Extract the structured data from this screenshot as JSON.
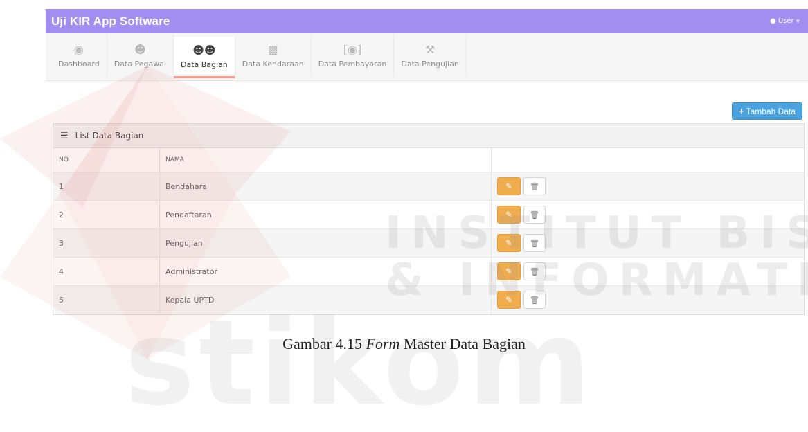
{
  "app": {
    "title": "Uji KIR App Software",
    "user_label": "User",
    "accent": "#a28ef0"
  },
  "nav": {
    "items": [
      {
        "label": "Dashboard",
        "icon": "dashboard-icon"
      },
      {
        "label": "Data Pegawai",
        "icon": "user-icon"
      },
      {
        "label": "Data Bagian",
        "icon": "users-icon",
        "active": true
      },
      {
        "label": "Data Kendaraan",
        "icon": "truck-icon"
      },
      {
        "label": "Data Pembayaran",
        "icon": "money-icon"
      },
      {
        "label": "Data Pengujian",
        "icon": "wrench-icon"
      }
    ]
  },
  "toolbar": {
    "add_label": "Tambah Data"
  },
  "panel": {
    "title": "List Data Bagian"
  },
  "table": {
    "headers": [
      "NO",
      "NAMA"
    ],
    "rows": [
      {
        "no": "1",
        "nama": "Bendahara"
      },
      {
        "no": "2",
        "nama": "Pendaftaran"
      },
      {
        "no": "3",
        "nama": "Pengujian"
      },
      {
        "no": "4",
        "nama": "Administrator"
      },
      {
        "no": "5",
        "nama": "Kepala UPTD"
      }
    ]
  },
  "watermark": {
    "line1": "INSTITUT BISNIS",
    "line2": "& INFORMATIKA",
    "big": "stikom"
  },
  "caption": {
    "prefix": "Gambar 4.15 ",
    "em": "Form",
    "suffix": " Master Data Bagian"
  }
}
